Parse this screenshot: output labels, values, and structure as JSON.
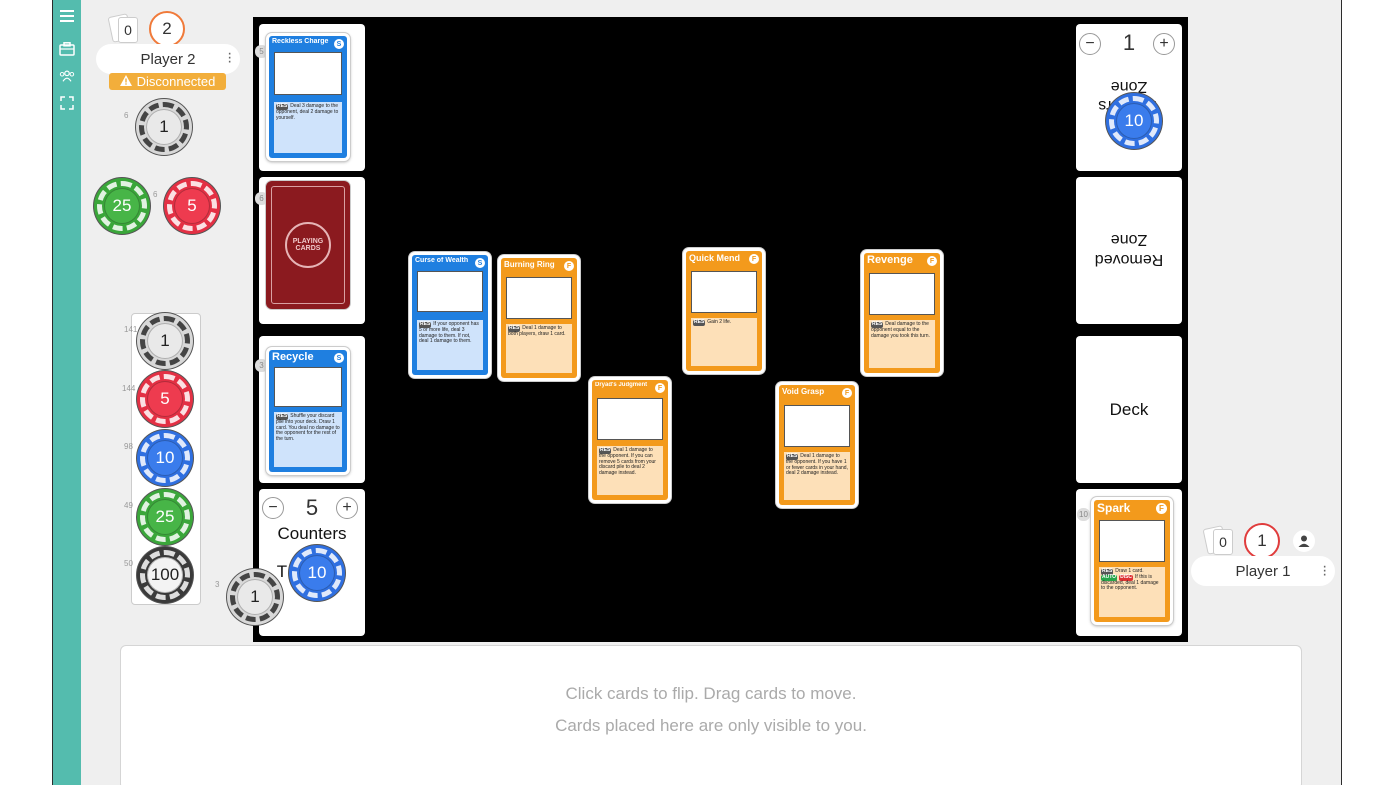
{
  "sidebar": {
    "icons": [
      "menu-icon",
      "briefcase-icon",
      "users-icon",
      "fullscreen-icon"
    ]
  },
  "opponent": {
    "hand_count": "0",
    "score": "2",
    "name": "Player 2",
    "status": "Disconnected",
    "score_color": "#f07a3a"
  },
  "player": {
    "hand_count": "0",
    "score": "1",
    "name": "Player 1",
    "score_color": "#e03c3c"
  },
  "zones": {
    "trackers_label_1": "Trackers",
    "trackers_label_2": "Zone",
    "trackers_value": "1",
    "removed_label_1": "Removed",
    "removed_label_2": "Zone",
    "deck_label": "Deck",
    "counters_value": "5",
    "counters_label": "Counters",
    "counters_label_2": "T",
    "zone_counts": {
      "opp_top": "5",
      "opp_back": "6",
      "opp_recycle": "3",
      "player_spark": "10"
    }
  },
  "chips": {
    "opponent_single": {
      "value": "1",
      "count": "6"
    },
    "opponent_green": {
      "value": "25",
      "count": ""
    },
    "opponent_red": {
      "value": "5",
      "count": "6"
    },
    "tray": [
      {
        "value": "1",
        "count": "141",
        "color": "white"
      },
      {
        "value": "5",
        "count": "144",
        "color": "red"
      },
      {
        "value": "10",
        "count": "98",
        "color": "blue"
      },
      {
        "value": "25",
        "count": "49",
        "color": "green"
      },
      {
        "value": "100",
        "count": "50",
        "color": "black"
      }
    ],
    "loose_white": {
      "value": "1",
      "count": "3"
    },
    "counters_blue": {
      "value": "10"
    },
    "trackers_blue": {
      "value": "10"
    }
  },
  "cards": {
    "reckless_charge": {
      "title": "Reckless Charge",
      "type": "S",
      "tag": "RES",
      "text": "Deal 3 damage to the opponent, deal 2 damage to yourself."
    },
    "cardback_emblem": "PLAYING CARDS",
    "recycle": {
      "title": "Recycle",
      "type": "S",
      "tag": "RES",
      "text": "Shuffle your discard pile into your deck. Draw 1 card. You deal no damage to the opponent for the rest of the turn."
    },
    "curse_of_wealth": {
      "title": "Curse of Wealth",
      "type": "S",
      "tag": "RES",
      "text": "If your opponent has 5 or more life, deal 3 damage to them. If not, deal 1 damage to them."
    },
    "burning_ring": {
      "title": "Burning Ring",
      "type": "F",
      "tag": "RES",
      "text": "Deal 1 damage to both players, draw 1 card."
    },
    "dryads_judgment": {
      "title": "Dryad's Judgment",
      "type": "F",
      "tag": "RES",
      "text": "Deal 1 damage to the opponent. If you can remove 5 cards from your discard pile to deal 2 damage instead."
    },
    "quick_mend": {
      "title": "Quick Mend",
      "type": "F",
      "tag": "RES",
      "text": "Gain 2 life."
    },
    "void_grasp": {
      "title": "Void Grasp",
      "type": "F",
      "tag": "RES",
      "text": "Deal 1 damage to the opponent. If you have 1 or fewer cards in your hand, deal 2 damage instead."
    },
    "revenge": {
      "title": "Revenge",
      "type": "F",
      "tag": "RES",
      "text": "Deal damage to the opponent equal to the damage you took this turn."
    },
    "spark": {
      "title": "Spark",
      "type": "F",
      "tag": "RES",
      "text": "Draw 1 card.",
      "tag2": "AUTO",
      "tag3": "DISC",
      "text2": "If this is discarded, deal 1 damage to the opponent."
    }
  },
  "hand_area": {
    "line1": "Click cards to flip.   Drag cards to move.",
    "line2": "Cards placed here are only visible to you."
  }
}
